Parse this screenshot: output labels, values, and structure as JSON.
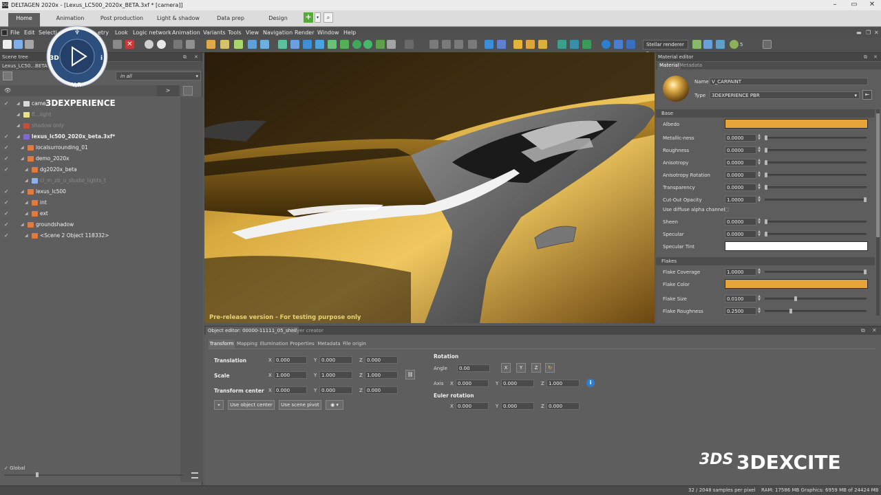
{
  "window": {
    "title": "DELTAGEN  2020x - [Lexus_LC500_2020x_BETA.3xf * [camera]]",
    "app_icon": "DG"
  },
  "ribbon_tabs": [
    "Home",
    "Animation",
    "Post production",
    "Light & shadow",
    "Data prep",
    "Design"
  ],
  "menu": [
    "File",
    "Edit",
    "Selection",
    "Geometry",
    "Look",
    "Logic network",
    "Animation",
    "Variants",
    "Tools",
    "View",
    "Navigation",
    "Render",
    "Window",
    "Help"
  ],
  "menu_visible": {
    "selection": "Selecti",
    "geometry": "etry"
  },
  "toolbar": {
    "renderer": "Stellar renderer",
    "badge": "5"
  },
  "scene_tree": {
    "header": "Scene tree",
    "file_tab": "Lexus_LC50...BETA",
    "filter": "in all",
    "arrow": ">",
    "rows": [
      {
        "label": "came",
        "check": "✓",
        "indent": 34,
        "icon": "#d9d9d9",
        "dim": false
      },
      {
        "label": "fl...light",
        "check": "",
        "indent": 34,
        "icon": "#e8e08a",
        "dim": true
      },
      {
        "label": "shadow only",
        "check": "",
        "indent": 34,
        "icon": "#c0503c",
        "dim": true
      },
      {
        "label": "lexus_lc500_2020x_beta.3xf*",
        "check": "✓",
        "indent": 34,
        "icon": "#7e6bd0",
        "dim": false,
        "bold": true
      },
      {
        "label": "localsurrounding_01",
        "check": "✓",
        "indent": 40,
        "icon": "#e07a45",
        "dim": false
      },
      {
        "label": "demo_2020x",
        "check": "✓",
        "indent": 40,
        "icon": "#e07a45",
        "dim": false
      },
      {
        "label": "dg2020x_beta",
        "check": "✓",
        "indent": 46,
        "icon": "#e07a45",
        "dim": false
      },
      {
        "label": "cl_m_zb_u_studio_lights_t",
        "check": "",
        "indent": 46,
        "icon": "#8fb3e8",
        "dim": true
      },
      {
        "label": "lexus_lc500",
        "check": "✓",
        "indent": 40,
        "icon": "#e07a45",
        "dim": false
      },
      {
        "label": "int",
        "check": "✓",
        "indent": 46,
        "icon": "#e07a45",
        "dim": false
      },
      {
        "label": "ext",
        "check": "✓",
        "indent": 46,
        "icon": "#e07a45",
        "dim": false
      },
      {
        "label": "groundshadow",
        "check": "✓",
        "indent": 40,
        "icon": "#e07a45",
        "dim": false
      },
      {
        "label": "<Scene 2 Object 118332>",
        "check": "✓",
        "indent": 46,
        "icon": "#e07a45",
        "dim": false
      }
    ],
    "global_label": "Global"
  },
  "logo_3dx": {
    "experience_brand": "3DEXPERIENCE",
    "compass_3d": "3D",
    "compass_i": "i",
    "compass_vr": "V,R"
  },
  "viewport": {
    "watermark": "Pre-release version - For testing purpose only",
    "brand": "3DEXCITE",
    "brand_mark": "3DS"
  },
  "material_editor": {
    "header": "Material editor",
    "tabs": [
      "Material",
      "Metadata"
    ],
    "name_label": "Name",
    "name_value": "V_CARPAINT",
    "type_label": "Type",
    "type_value": "3DEXPERIENCE PBR",
    "sections": {
      "base": "Base",
      "flakes": "Flakes"
    },
    "albedo_label": "Albedo",
    "albedo_color": "#e7a438",
    "base_params": [
      {
        "label": "Metallic-ness",
        "value": "0.0000",
        "fraction": 0.0
      },
      {
        "label": "Roughness",
        "value": "0.0000",
        "fraction": 0.0
      },
      {
        "label": "Anisotropy",
        "value": "0.0000",
        "fraction": 0.0
      },
      {
        "label": "Anisotropy Rotation",
        "value": "0.0000",
        "fraction": 0.0
      },
      {
        "label": "Transparency",
        "value": "0.0000",
        "fraction": 0.0
      },
      {
        "label": "Cut-Out Opacity",
        "value": "1.0000",
        "fraction": 1.0
      }
    ],
    "diffuse_alpha_label": "Use diffuse alpha channel",
    "sheen_label": "Sheen",
    "sheen_value": "0.0000",
    "sheen_fraction": 0.0,
    "specular_label": "Specular",
    "specular_value": "0.0000",
    "specular_fraction": 0.0,
    "specular_tint_label": "Specular Tint",
    "specular_tint_color": "#ffffff",
    "flake_coverage_label": "Flake Coverage",
    "flake_coverage_value": "1.0000",
    "flake_coverage_fraction": 1.0,
    "flake_color_label": "Flake Color",
    "flake_color": "#e7a438",
    "flake_size_label": "Flake Size",
    "flake_size_value": "0.0100",
    "flake_size_fraction": 0.3,
    "flake_roughness_label": "Flake Roughness",
    "flake_roughness_value": "0.2500",
    "flake_roughness_fraction": 0.25
  },
  "object_editor": {
    "title": "Object editor: 00000-11111_05_shell",
    "layer_tab": "Layer creator",
    "tabs": [
      "Transform",
      "Mapping",
      "Illumination",
      "Properties",
      "Metadata",
      "File origin"
    ],
    "translation_label": "Translation",
    "translation": {
      "x": "0.000",
      "y": "0.000",
      "z": "0.000"
    },
    "scale_label": "Scale",
    "scale": {
      "x": "1.000",
      "y": "1.000",
      "z": "1.000"
    },
    "center_label": "Transform center",
    "center": {
      "x": "0.000",
      "y": "0.000",
      "z": "0.000"
    },
    "use_object_center": "Use object center",
    "use_scene_pivot": "Use scene pivot",
    "rotation_label": "Rotation",
    "angle_label": "Angle",
    "angle_value": "0.00",
    "axis_label": "Axis",
    "axis": {
      "x": "0.000",
      "y": "0.000",
      "z": "1.000"
    },
    "euler_label": "Euler rotation",
    "euler": {
      "x": "0.000",
      "y": "0.000",
      "z": "0.000"
    },
    "btn_x": "X",
    "btn_y": "Y",
    "btn_z": "Z",
    "axis_x": "X",
    "axis_y": "Y",
    "axis_z": "Z"
  },
  "status": {
    "samples": "32 / 2048 samples per pixel",
    "ram": "RAM: 17586 MB Graphics: 6959 MB of 24424 MB"
  }
}
